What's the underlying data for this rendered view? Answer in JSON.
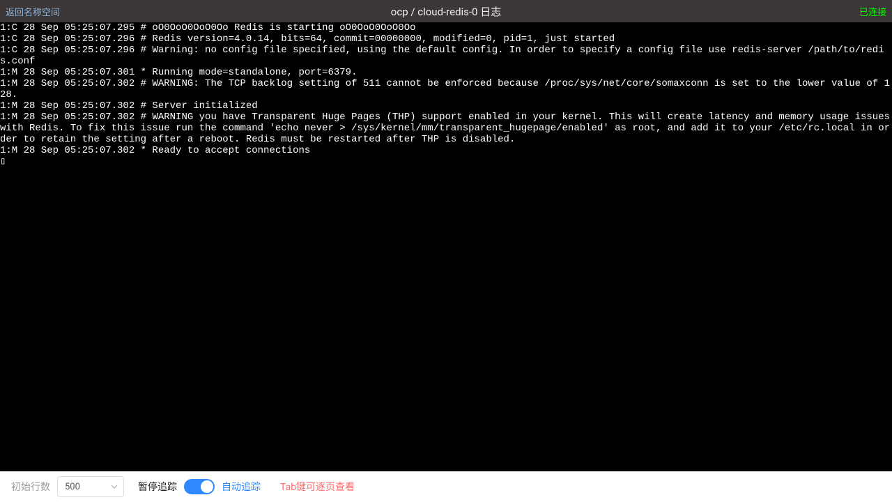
{
  "header": {
    "back_link": "返回名称空间",
    "title": "ocp / cloud-redis-0 日志",
    "status": "已连接"
  },
  "logs": "1:C 28 Sep 05:25:07.295 # oO0OoO0OoO0Oo Redis is starting oO0OoO0OoO0Oo\n1:C 28 Sep 05:25:07.296 # Redis version=4.0.14, bits=64, commit=00000000, modified=0, pid=1, just started\n1:C 28 Sep 05:25:07.296 # Warning: no config file specified, using the default config. In order to specify a config file use redis-server /path/to/redis.conf\n1:M 28 Sep 05:25:07.301 * Running mode=standalone, port=6379.\n1:M 28 Sep 05:25:07.302 # WARNING: The TCP backlog setting of 511 cannot be enforced because /proc/sys/net/core/somaxconn is set to the lower value of 128.\n1:M 28 Sep 05:25:07.302 # Server initialized\n1:M 28 Sep 05:25:07.302 # WARNING you have Transparent Huge Pages (THP) support enabled in your kernel. This will create latency and memory usage issues with Redis. To fix this issue run the command 'echo never > /sys/kernel/mm/transparent_hugepage/enabled' as root, and add it to your /etc/rc.local in order to retain the setting after a reboot. Redis must be restarted after THP is disabled.\n1:M 28 Sep 05:25:07.302 * Ready to accept connections\n▯",
  "footer": {
    "initial_lines_label": "初始行数",
    "initial_lines_value": "500",
    "pause_tail_label": "暂停追踪",
    "auto_tail_label": "自动追踪",
    "hint": "Tab键可逐页查看"
  }
}
